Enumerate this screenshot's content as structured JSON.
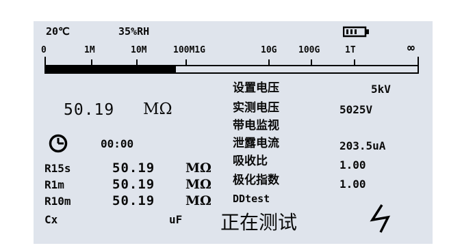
{
  "header": {
    "temperature": "20℃",
    "humidity": "35%RH",
    "battery_icon": "battery-icon"
  },
  "scale": {
    "labels": [
      "0",
      "1M",
      "10M",
      "100M1G",
      "10G",
      "100G",
      "1T",
      "∞"
    ],
    "fill_fraction": 0.35
  },
  "main": {
    "resistance_value": "50.19",
    "resistance_unit": "MΩ",
    "clock_icon": "clock-icon",
    "elapsed_time": "00:00"
  },
  "rows": [
    {
      "label": "R15s",
      "value": "50.19",
      "unit": "MΩ"
    },
    {
      "label": "R1m",
      "value": "50.19",
      "unit": "MΩ"
    },
    {
      "label": "R10m",
      "value": "50.19",
      "unit": "MΩ"
    }
  ],
  "capacitance": {
    "label": "Cx",
    "unit": "uF"
  },
  "params": [
    {
      "label": "设置电压",
      "value": "5kV"
    },
    {
      "label": "实测电压",
      "value": "5025V"
    },
    {
      "label": "带电监视",
      "value": ""
    },
    {
      "label": "泄露电流",
      "value": "203.5uA"
    },
    {
      "label": "吸收比",
      "value": "1.00"
    },
    {
      "label": "极化指数",
      "value": "1.00"
    }
  ],
  "test_name": "DDtest",
  "status": {
    "text": "正在测试",
    "icon": "high-voltage-icon"
  }
}
